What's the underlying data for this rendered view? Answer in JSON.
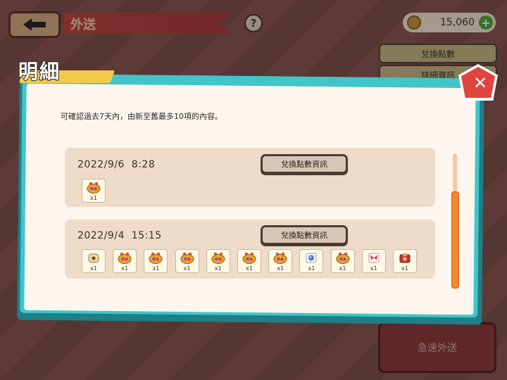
{
  "header": {
    "screen_title": "外送",
    "help_label": "?",
    "coins": "15,060",
    "coin_plus": "+"
  },
  "side_buttons": {
    "exchange_points": "兌換點數",
    "details": "詳細資訊"
  },
  "express_button": "急速外送",
  "modal": {
    "title": "明細",
    "description": "可確認過去7天內，由新至舊最多10項的內容。",
    "entries": [
      {
        "date": "2022/9/6",
        "time": "8:28",
        "info_button": "兌換點數資訊",
        "items": [
          {
            "icon": "cookie-bag-icon",
            "qty": "x1"
          }
        ]
      },
      {
        "date": "2022/9/4",
        "time": "15:15",
        "info_button": "兌換點數資訊",
        "items": [
          {
            "icon": "toast-icon",
            "qty": "x1"
          },
          {
            "icon": "cookie-bag-icon",
            "qty": "x1"
          },
          {
            "icon": "cookie-bag-icon",
            "qty": "x1"
          },
          {
            "icon": "cookie-bag-icon",
            "qty": "x1"
          },
          {
            "icon": "cookie-bag-icon",
            "qty": "x1"
          },
          {
            "icon": "cookie-bag-icon",
            "qty": "x1"
          },
          {
            "icon": "cookie-bag-icon",
            "qty": "x1"
          },
          {
            "icon": "blue-orb-icon",
            "qty": "x1"
          },
          {
            "icon": "cookie-bag-icon",
            "qty": "x1"
          },
          {
            "icon": "butterfly-icon",
            "qty": "x1"
          },
          {
            "icon": "red-box-icon",
            "qty": "x1"
          }
        ]
      }
    ]
  },
  "colors": {
    "modal_frame": "#40c6c9",
    "entry_bg": "#efdcc8",
    "close_button": "#e0443f",
    "scroll_thumb": "#f3892a"
  }
}
